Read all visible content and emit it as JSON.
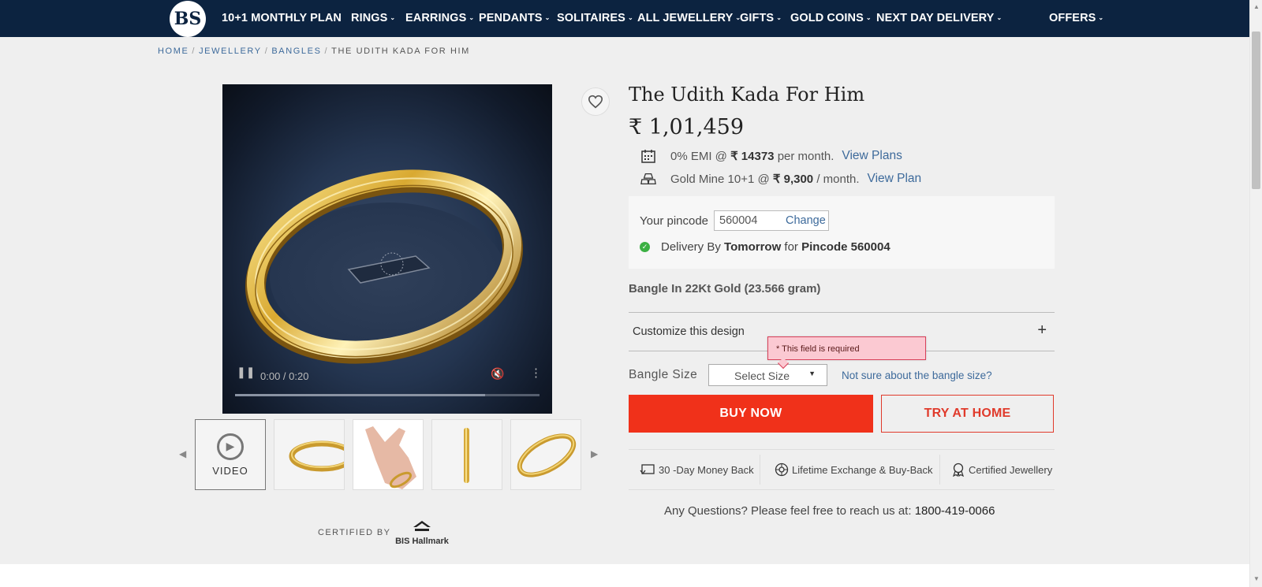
{
  "nav": {
    "logo_text": "BS",
    "items": [
      {
        "label": "10+1 MONTHLY PLAN"
      },
      {
        "label": "RINGS"
      },
      {
        "label": "EARRINGS"
      },
      {
        "label": "PENDANTS"
      },
      {
        "label": "SOLITAIRES"
      },
      {
        "label": "ALL JEWELLERY"
      },
      {
        "label": "GIFTS"
      },
      {
        "label": "GOLD COINS"
      },
      {
        "label": "NEXT DAY DELIVERY"
      },
      {
        "label": "OFFERS"
      }
    ]
  },
  "breadcrumb": {
    "items": [
      "HOME",
      "JEWELLERY",
      "BANGLES"
    ],
    "current": "THE UDITH KADA FOR HIM"
  },
  "video": {
    "time": "0:00 / 0:20",
    "progress_buffered": 0.82
  },
  "thumbnails": {
    "video_label": "VIDEO"
  },
  "certified": {
    "label": "CERTIFIED BY",
    "brand": "BIS Hallmark"
  },
  "product": {
    "title": "The Udith Kada For Him",
    "price": "₹ 1,01,459",
    "emi": {
      "prefix": "0% EMI @",
      "amount": "₹ 14373",
      "suffix": "per month.",
      "link": "View Plans"
    },
    "goldmine": {
      "prefix": "Gold Mine 10+1 @",
      "amount": "₹ 9,300",
      "suffix": "/ month.",
      "link": "View Plan"
    },
    "pincode": {
      "label": "Your pincode",
      "value": "560004",
      "change": "Change",
      "delivery_prefix": "Delivery By",
      "delivery_day": "Tomorrow",
      "delivery_mid": "for",
      "delivery_pin": "Pincode 560004"
    },
    "description": "Bangle In 22Kt Gold (23.566 gram)",
    "customize": {
      "label": "Customize this design",
      "icon": "+"
    },
    "size": {
      "label": "Bangle Size",
      "select_placeholder": "Select Size",
      "help": "Not sure about the bangle size?",
      "error": "* This field is required"
    },
    "buy_label": "BUY NOW",
    "try_label": "TRY AT HOME",
    "assurances": [
      {
        "label": "30 -Day Money Back",
        "icon": "return-icon"
      },
      {
        "label": "Lifetime Exchange & Buy-Back",
        "icon": "exchange-icon"
      },
      {
        "label": "Certified Jewellery",
        "icon": "certificate-icon"
      }
    ],
    "questions": {
      "text": "Any Questions? Please feel free to reach us at:",
      "phone": "1800-419-0066"
    }
  },
  "colors": {
    "nav_bg": "#0c2340",
    "accent_red": "#f0311a",
    "link_blue": "#3d6a9b",
    "error_bg": "#fbc9d2"
  }
}
